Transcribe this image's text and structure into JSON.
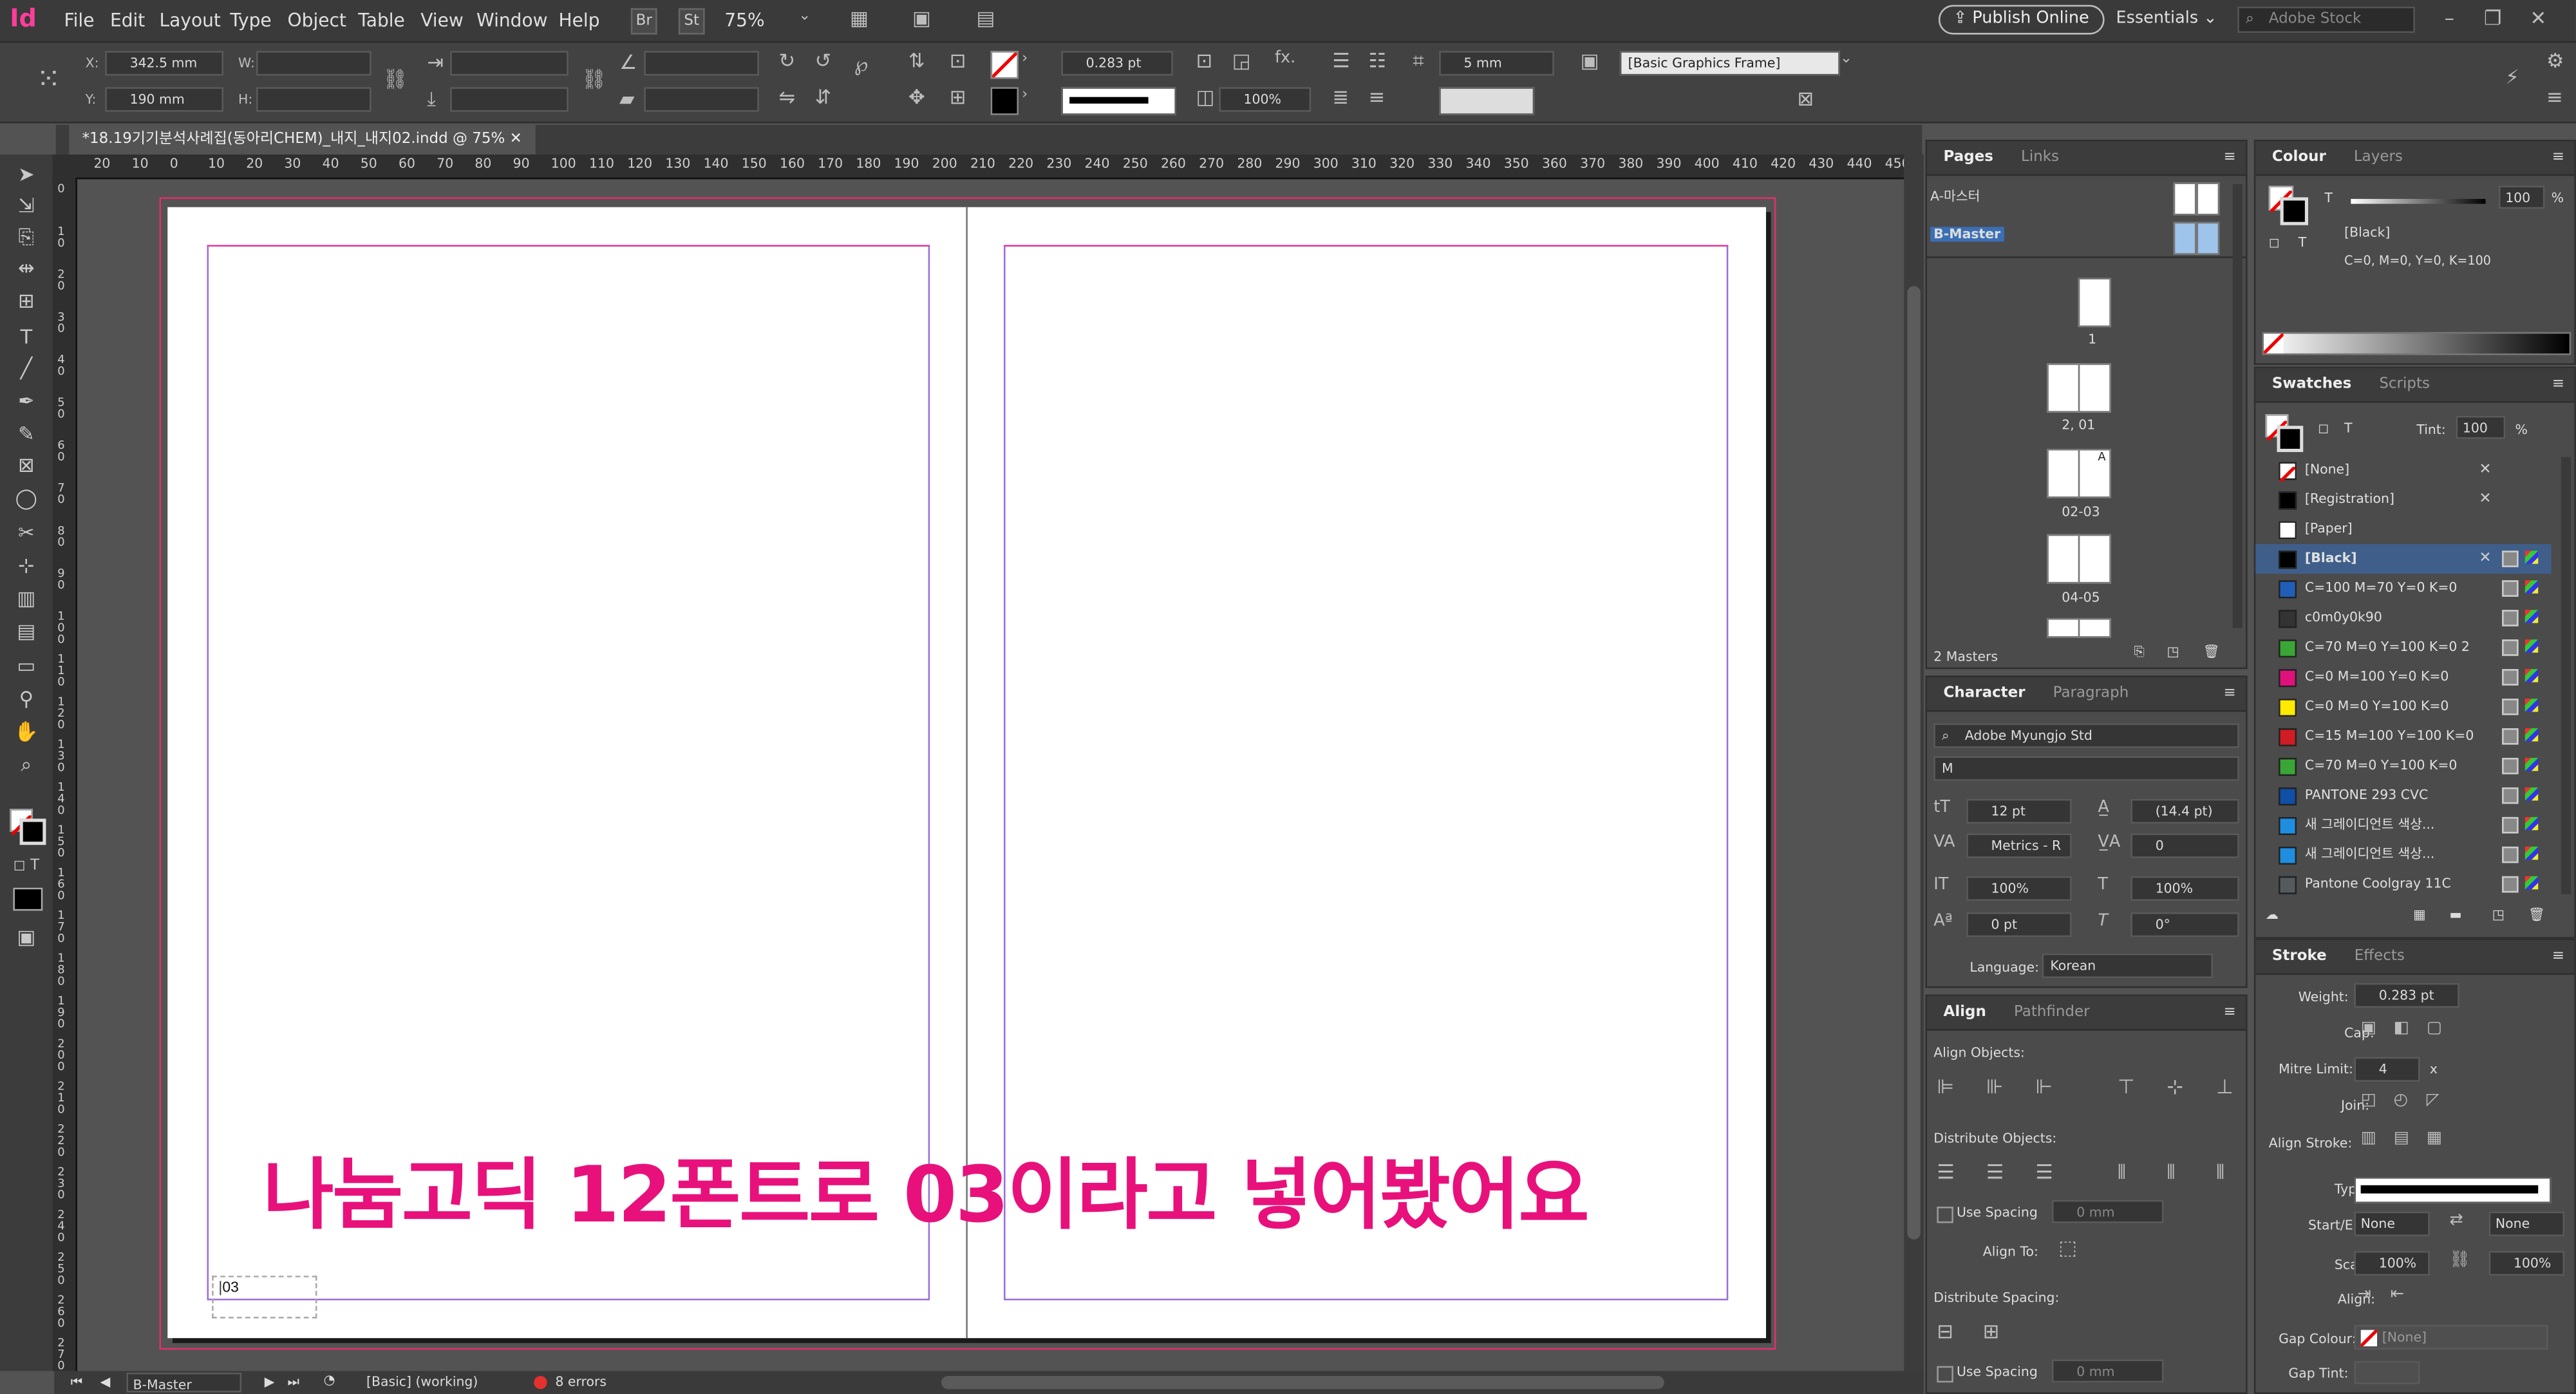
{
  "menubar": {
    "app_logo": "Id",
    "items": [
      "File",
      "Edit",
      "Layout",
      "Type",
      "Object",
      "Table",
      "View",
      "Window",
      "Help"
    ],
    "bridge_btn": "Br",
    "stock_btn": "St",
    "zoom": "75%",
    "publish_online": "Publish Online",
    "workspace": "Essentials",
    "search_placeholder": "Adobe Stock"
  },
  "control": {
    "x_label": "X:",
    "x_value": "342.5 mm",
    "y_label": "Y:",
    "y_value": "190 mm",
    "w_label": "W:",
    "h_label": "H:",
    "stroke_weight": "0.283 pt",
    "opacity": "100%",
    "frame_value": "5 mm",
    "object_style": "[Basic Graphics Frame]"
  },
  "document": {
    "tab_title": "*18.19기기분석사례집(동아리CHEM)_내지_내지02.indd @ 75%",
    "folio_text": "03",
    "annotation": "나눔고딕 12폰트로 03이라고 넣어봤어요"
  },
  "ruler": {
    "h_ticks": [
      "20",
      "10",
      "0",
      "10",
      "20",
      "30",
      "40",
      "50",
      "60",
      "70",
      "80",
      "90",
      "100",
      "110",
      "120",
      "130",
      "140",
      "150",
      "160",
      "170",
      "180",
      "190",
      "200",
      "210",
      "220",
      "230",
      "240",
      "250",
      "260",
      "270",
      "280",
      "290",
      "300",
      "310",
      "320",
      "330",
      "340",
      "350",
      "360",
      "370",
      "380",
      "390",
      "400",
      "410",
      "420",
      "430",
      "440",
      "450"
    ],
    "v_ticks": [
      "0",
      "1 0",
      "2 0",
      "3 0",
      "4 0",
      "5 0",
      "6 0",
      "7 0",
      "8 0",
      "9 0",
      "1 0 0",
      "1 1 0",
      "1 2 0",
      "1 3 0",
      "1 4 0",
      "1 5 0",
      "1 6 0",
      "1 7 0",
      "1 8 0",
      "1 9 0",
      "2 0 0",
      "2 1 0",
      "2 2 0",
      "2 3 0",
      "2 4 0",
      "2 5 0",
      "2 6 0",
      "2 7 0"
    ]
  },
  "status": {
    "page": "B-Master",
    "preflight_profile": "[Basic] (working)",
    "errors": "8 errors"
  },
  "pages_panel": {
    "tab_active": "Pages",
    "tab_inactive": "Links",
    "masters": [
      "A-마스터",
      "B-Master"
    ],
    "page_labels": [
      "1",
      "2, 01",
      "02-03",
      "04-05"
    ],
    "master_letter": "A",
    "footer": "2 Masters"
  },
  "colour_panel": {
    "tab_active": "Colour",
    "tab_inactive": "Layers",
    "tint_label": "T",
    "tint_value": "100",
    "percent": "%",
    "swatch_name": "[Black]",
    "cmyk": "C=0, M=0, Y=0, K=100"
  },
  "swatches_panel": {
    "tab_active": "Swatches",
    "tab_inactive": "Scripts",
    "tint_label": "Tint:",
    "tint_value": "100",
    "percent": "%",
    "items": [
      {
        "name": "[None]",
        "color": "#ffffff"
      },
      {
        "name": "[Registration]",
        "color": "#000000"
      },
      {
        "name": "[Paper]",
        "color": "#ffffff"
      },
      {
        "name": "[Black]",
        "color": "#000000"
      },
      {
        "name": "C=100 M=70 Y=0 K=0",
        "color": "#1f5fb8"
      },
      {
        "name": "c0m0y0k90",
        "color": "#333333"
      },
      {
        "name": "C=70 M=0 Y=100 K=0 2",
        "color": "#3aa635"
      },
      {
        "name": "C=0 M=100 Y=0 K=0",
        "color": "#e0117d"
      },
      {
        "name": "C=0 M=0 Y=100 K=0",
        "color": "#ffea00"
      },
      {
        "name": "C=15 M=100 Y=100 K=0",
        "color": "#d01c24"
      },
      {
        "name": "C=70 M=0 Y=100 K=0",
        "color": "#3aa635"
      },
      {
        "name": "PANTONE 293 CVC",
        "color": "#0f4fa8"
      },
      {
        "name": "새 그레이디언트 색상...",
        "color": "#1f8ee0"
      },
      {
        "name": "새 그레이디언트 색상...",
        "color": "#1f8ee0"
      },
      {
        "name": "Pantone Coolgray 11C",
        "color": "#555a5e"
      }
    ]
  },
  "character_panel": {
    "tab_active": "Character",
    "tab_inactive": "Paragraph",
    "font": "Adobe Myungjo Std",
    "style": "M",
    "size": "12 pt",
    "leading": "(14.4 pt)",
    "kerning": "Metrics - R",
    "tracking": "0",
    "vscale": "100%",
    "hscale": "100%",
    "baseline": "0 pt",
    "skew": "0°",
    "language_label": "Language:",
    "language": "Korean"
  },
  "align_panel": {
    "tab_active": "Align",
    "tab_inactive": "Pathfinder",
    "align_objects": "Align Objects:",
    "distribute_objects": "Distribute Objects:",
    "use_spacing": "Use Spacing",
    "spacing_value": "0 mm",
    "align_to": "Align To:",
    "distribute_spacing": "Distribute Spacing:"
  },
  "stroke_panel": {
    "tab_active": "Stroke",
    "tab_inactive": "Effects",
    "weight_label": "Weight:",
    "weight": "0.283 pt",
    "cap_label": "Cap:",
    "mitre_label": "Mitre Limit:",
    "mitre": "4",
    "mitre_unit": "x",
    "join_label": "Join:",
    "align_stroke_label": "Align Stroke:",
    "type_label": "Type:",
    "startend_label": "Start/End:",
    "start": "None",
    "end": "None",
    "scale_label": "Scale:",
    "scale1": "100%",
    "scale2": "100%",
    "align_label": "Align:",
    "gap_colour_label": "Gap Colour:",
    "gap_colour": "[None]",
    "gap_tint_label": "Gap Tint:"
  }
}
